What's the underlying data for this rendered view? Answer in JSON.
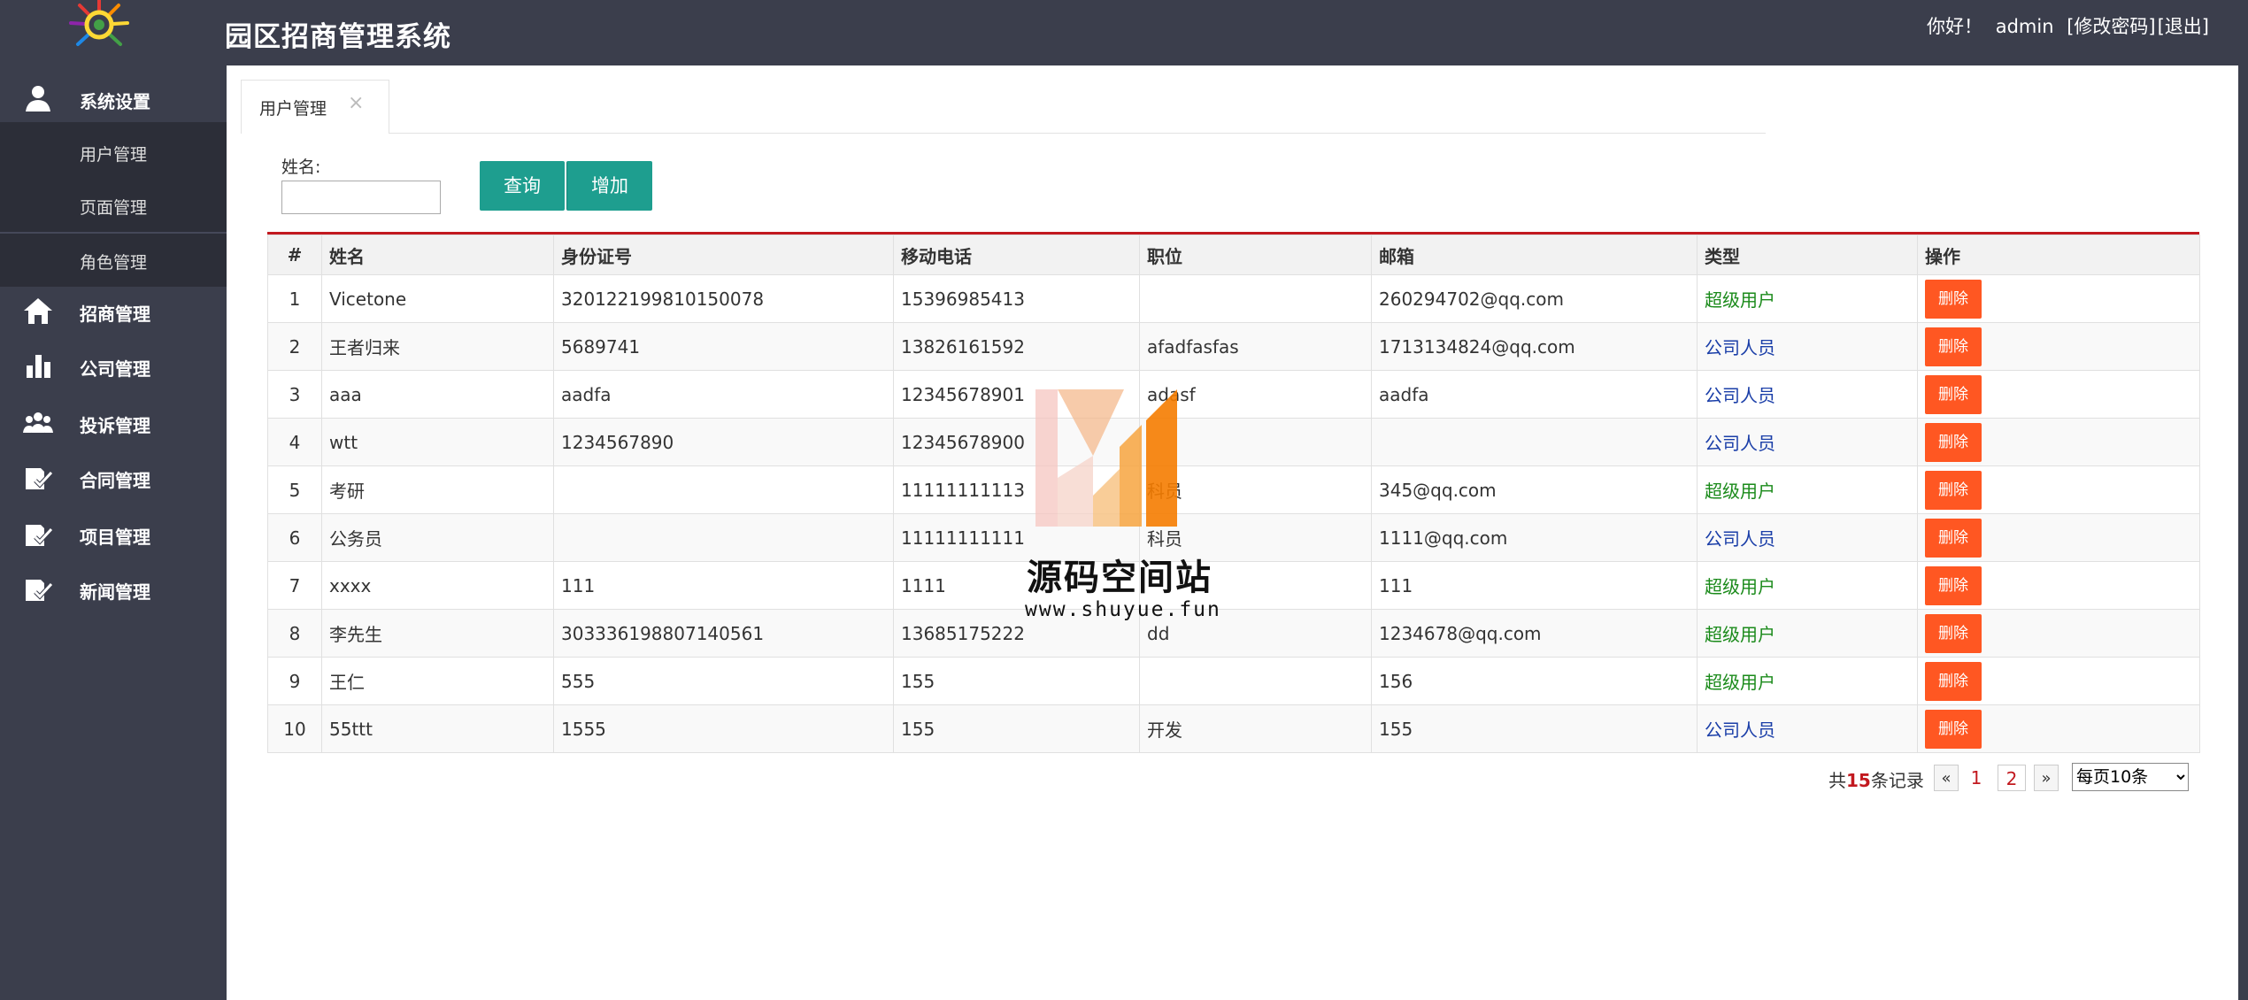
{
  "header": {
    "app_title": "园区招商管理系统",
    "greeting": "你好！",
    "user": "admin",
    "change_password": "[修改密码]",
    "logout": "[退出]"
  },
  "sidebar": {
    "items": [
      {
        "label": "系统设置",
        "icon": "user-icon"
      },
      {
        "label": "招商管理",
        "icon": "home-icon"
      },
      {
        "label": "公司管理",
        "icon": "bar-chart-icon"
      },
      {
        "label": "投诉管理",
        "icon": "group-icon"
      },
      {
        "label": "合同管理",
        "icon": "edit-check-icon"
      },
      {
        "label": "项目管理",
        "icon": "edit-check-icon"
      },
      {
        "label": "新闻管理",
        "icon": "edit-check-icon"
      }
    ],
    "sub_items": [
      {
        "label": "用户管理"
      },
      {
        "label": "页面管理"
      },
      {
        "label": "角色管理"
      }
    ]
  },
  "tabs": [
    {
      "label": "用户管理",
      "close": "×"
    }
  ],
  "search": {
    "name_label": "姓名:",
    "name_value": "",
    "query_label": "查询",
    "add_label": "增加"
  },
  "table": {
    "headers": [
      "#",
      "姓名",
      "身份证号",
      "移动电话",
      "职位",
      "邮箱",
      "类型",
      "操作"
    ],
    "delete_label": "删除",
    "rows": [
      {
        "no": "1",
        "name": "Vicetone",
        "id_card": "320122199810150078",
        "phone": "15396985413",
        "position": "",
        "email": "260294702@qq.com",
        "type": "超级用户",
        "type_kind": "super"
      },
      {
        "no": "2",
        "name": "王者归来",
        "id_card": "5689741",
        "phone": "13826161592",
        "position": "afadfasfas",
        "email": "1713134824@qq.com",
        "type": "公司人员",
        "type_kind": "staff"
      },
      {
        "no": "3",
        "name": "aaa",
        "id_card": "aadfa",
        "phone": "12345678901",
        "position": "adasf",
        "email": "aadfa",
        "type": "公司人员",
        "type_kind": "staff"
      },
      {
        "no": "4",
        "name": "wtt",
        "id_card": "1234567890",
        "phone": "12345678900",
        "position": "",
        "email": "",
        "type": "公司人员",
        "type_kind": "staff"
      },
      {
        "no": "5",
        "name": "考研",
        "id_card": "",
        "phone": "11111111113",
        "position": "科员",
        "email": "345@qq.com",
        "type": "超级用户",
        "type_kind": "super"
      },
      {
        "no": "6",
        "name": "公务员",
        "id_card": "",
        "phone": "11111111111",
        "position": "科员",
        "email": "1111@qq.com",
        "type": "公司人员",
        "type_kind": "staff"
      },
      {
        "no": "7",
        "name": "xxxx",
        "id_card": "111",
        "phone": "1111",
        "position": "",
        "email": "111",
        "type": "超级用户",
        "type_kind": "super"
      },
      {
        "no": "8",
        "name": "李先生",
        "id_card": "303336198807140561",
        "phone": "13685175222",
        "position": "dd",
        "email": "1234678@qq.com",
        "type": "超级用户",
        "type_kind": "super"
      },
      {
        "no": "9",
        "name": "王仁",
        "id_card": "555",
        "phone": "155",
        "position": "",
        "email": "156",
        "type": "超级用户",
        "type_kind": "super"
      },
      {
        "no": "10",
        "name": "55ttt",
        "id_card": "1555",
        "phone": "155",
        "position": "开发",
        "email": "155",
        "type": "公司人员",
        "type_kind": "staff"
      }
    ]
  },
  "pagination": {
    "total_prefix": "共",
    "total_count": "15",
    "total_suffix": "条记录",
    "prev": "«",
    "next": "»",
    "pages": [
      "1",
      "2"
    ],
    "per_page_selected": "每页10条"
  },
  "watermark": {
    "text": "源码空间站",
    "url": "www.shuyue.fun"
  },
  "colors": {
    "header_bg": "#3b3e4c",
    "primary_button": "#1e9e8f",
    "delete_button": "#ff5722",
    "table_top_border": "#c2191f",
    "super_user": "#1a8a1a",
    "staff_user": "#1a3ea8"
  }
}
